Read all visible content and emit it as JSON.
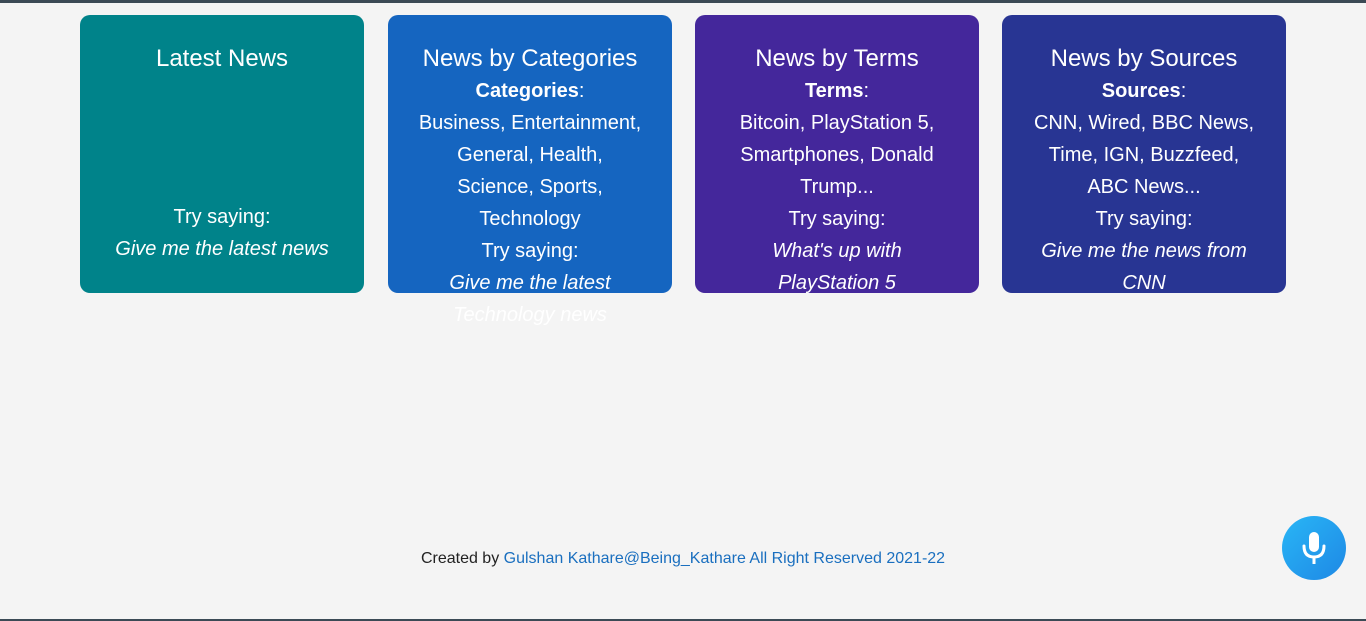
{
  "cards": [
    {
      "title": "Latest News",
      "try_label": "Try saying:",
      "example": "Give me the latest news"
    },
    {
      "title": "News by Categories",
      "list_label": "Categories",
      "list_line1": "Business, Entertainment,",
      "list_line2": "General, Health,",
      "list_line3": "Science, Sports,",
      "list_line4": "Technology",
      "try_label": "Try saying:",
      "example_line1": "Give me the latest",
      "example_line2": "Technology news"
    },
    {
      "title": "News by Terms",
      "list_label": "Terms",
      "list_line1": "Bitcoin, PlayStation 5,",
      "list_line2": "Smartphones, Donald",
      "list_line3": "Trump...",
      "try_label": "Try saying:",
      "example_line1": "What's up with",
      "example_line2": "PlayStation 5"
    },
    {
      "title": "News by Sources",
      "list_label": "Sources",
      "list_line1": "CNN, Wired, BBC News,",
      "list_line2": "Time, IGN, Buzzfeed,",
      "list_line3": "ABC News...",
      "try_label": "Try saying:",
      "example_line1": "Give me the news from",
      "example_line2": "CNN"
    }
  ],
  "footer": {
    "prefix": "Created by",
    "link_text": "Gulshan Kathare@Being_Kathare All Right Reserved 2021-22"
  },
  "mic_button": {
    "icon": "microphone-icon",
    "colors": [
      "#29b6f6",
      "#1e88e5"
    ]
  },
  "colors": {
    "card_latest": "#00838a",
    "card_categories": "#1565c0",
    "card_terms": "#44279b",
    "card_sources": "#283593",
    "background": "#f4f4f4",
    "link": "#1a6fbf"
  }
}
